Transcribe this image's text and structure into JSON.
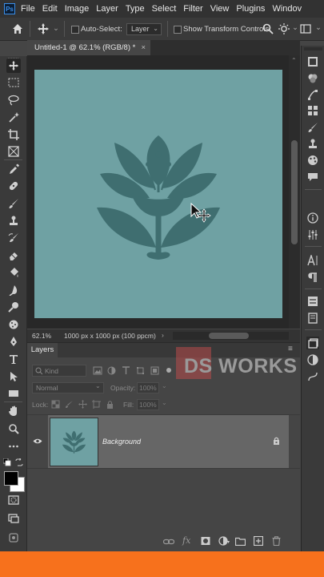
{
  "menubar": {
    "logo": "Ps",
    "items": [
      "File",
      "Edit",
      "Image",
      "Layer",
      "Type",
      "Select",
      "Filter",
      "View",
      "Plugins",
      "Windov"
    ]
  },
  "options": {
    "auto_select_label": "Auto-Select:",
    "auto_select_value": "Layer",
    "transform_label": "Show Transform Controls"
  },
  "document": {
    "tab_title": "Untitled-1 @ 62.1% (RGB/8) *",
    "close_glyph": "×",
    "canvas_color": "#6fa1a3",
    "artwork_color": "#3f6e70"
  },
  "status": {
    "zoom": "62.1%",
    "info": "1000 px x 1000 px (100 ppcm)",
    "arrow": "›"
  },
  "layers_panel": {
    "tab_label": "Layers",
    "kind_label": "Kind",
    "blend_mode": "Normal",
    "opacity_label": "Opacity:",
    "opacity_value": "100%",
    "lock_label": "Lock:",
    "fill_label": "Fill:",
    "fill_value": "100%",
    "layers": [
      {
        "name": "Background",
        "visible": true,
        "locked": true
      }
    ]
  },
  "watermark": {
    "text": "DS WORKS"
  },
  "colors": {
    "accent_bottom": "#f7711c",
    "foreground": "#000000",
    "background": "#ffffff"
  },
  "icons": {
    "toolbar": [
      "move-tool-icon",
      "marquee-tool-icon",
      "lasso-tool-icon",
      "magic-wand-icon",
      "crop-tool-icon",
      "frame-tool-icon",
      "eyedropper-icon",
      "healing-brush-icon",
      "brush-tool-icon",
      "clone-stamp-icon",
      "history-brush-icon",
      "eraser-icon",
      "paint-bucket-icon",
      "blur-tool-icon",
      "dodge-tool-icon",
      "sponge-icon",
      "pen-tool-icon",
      "type-tool-icon",
      "path-selection-icon",
      "rectangle-tool-icon",
      "hand-tool-icon",
      "zoom-tool-icon",
      "more-tools-icon"
    ]
  }
}
